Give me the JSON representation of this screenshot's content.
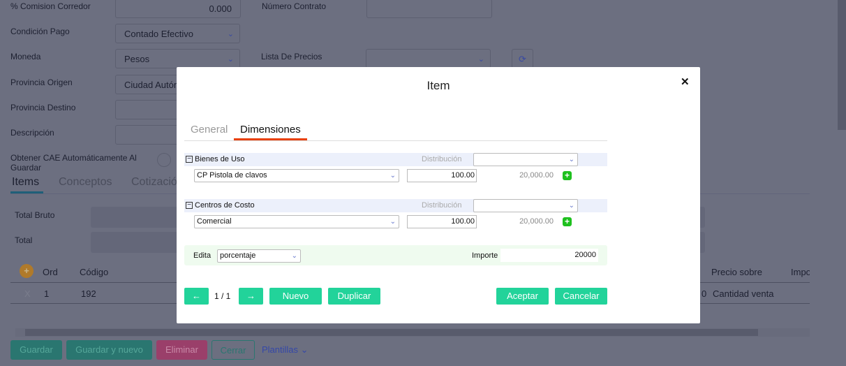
{
  "form": {
    "comision_label": "% Comision Corredor",
    "comision_value": "0.000",
    "numero_contrato_label": "Número Contrato",
    "condicion_pago_label": "Condición Pago",
    "condicion_pago_value": "Contado Efectivo",
    "moneda_label": "Moneda",
    "moneda_value": "Pesos",
    "lista_precios_label": "Lista De Precios",
    "provincia_origen_label": "Provincia Origen",
    "provincia_origen_value": "Ciudad Autónoma",
    "provincia_destino_label": "Provincia Destino",
    "descripcion_label": "Descripción",
    "cae_label": "Obtener CAE Automáticamente Al Guardar"
  },
  "tabs": [
    "Items",
    "Conceptos",
    "Cotización"
  ],
  "totals": {
    "total_bruto": "Total Bruto",
    "total": "Total"
  },
  "table": {
    "headers": {
      "ord": "Ord",
      "codigo": "Código",
      "precio_sobre": "Precio sobre",
      "importe": "Impo"
    },
    "row": {
      "delete": "X",
      "ord": "1",
      "codigo": "192",
      "partial": "0",
      "precio_sobre": "Cantidad venta"
    }
  },
  "footer": {
    "guardar": "Guardar",
    "guardar_nuevo": "Guardar y nuevo",
    "eliminar": "Eliminar",
    "cerrar": "Cerrar",
    "plantillas": "Plantillas"
  },
  "modal": {
    "title": "Item",
    "close": "✕",
    "tabs": [
      "General",
      "Dimensiones"
    ],
    "sections": [
      {
        "title": "Bienes de Uso",
        "dist_label": "Distribución",
        "item": "CP Pistola de clavos",
        "pct": "100.00",
        "amount": "20,000.00"
      },
      {
        "title": "Centros de Costo",
        "dist_label": "Distribución",
        "item": "Comercial",
        "pct": "100.00",
        "amount": "20,000.00"
      }
    ],
    "edita_label": "Edita",
    "edita_value": "porcentaje",
    "importe_label": "Importe",
    "importe_value": "20000",
    "pager": "1 / 1",
    "nuevo": "Nuevo",
    "duplicar": "Duplicar",
    "aceptar": "Aceptar",
    "cancelar": "Cancelar"
  }
}
